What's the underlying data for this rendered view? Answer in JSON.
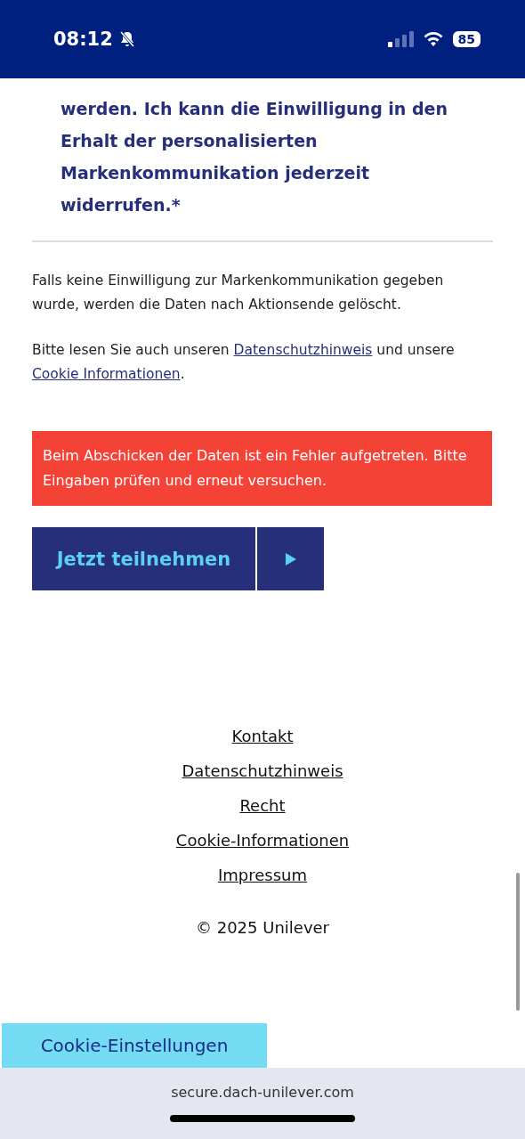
{
  "status_bar": {
    "time": "08:12",
    "muted": true,
    "battery": "85"
  },
  "consent_text": "werden. Ich kann die Einwilligung in den Erhalt der personalisierten Markenkommunikation jederzeit widerrufen.*",
  "info_text": "Falls keine Einwilligung zur Markenkommunikation gegeben wurde, werden die Daten nach Aktionsende gelöscht.",
  "privacy_notice": {
    "before": "Bitte lesen Sie auch unseren",
    "link_1": "Datenschutzhinweis",
    "middle": "und unsere",
    "link_2": "Cookie Informationen",
    "after": "."
  },
  "error_message": "Beim Abschicken der Daten ist ein Fehler aufgetreten. Bitte Eingaben prüfen und erneut versuchen.",
  "submit_button": {
    "label": "Jetzt teilnehmen"
  },
  "footer_links": [
    "Kontakt",
    "Datenschutzhinweis",
    "Recht",
    "Cookie-Informationen",
    "Impressum"
  ],
  "copyright": "© 2025 Unilever",
  "cookie_button": {
    "label": "Cookie-Einstellungen"
  },
  "address_bar": {
    "url": "secure.dach-unilever.com"
  }
}
